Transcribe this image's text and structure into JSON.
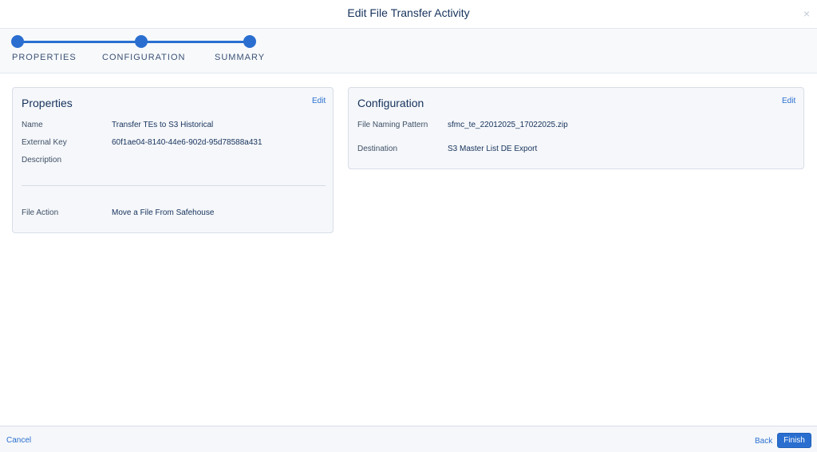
{
  "header": {
    "title": "Edit File Transfer Activity",
    "close_glyph": "×"
  },
  "stepper": {
    "steps": [
      {
        "label": "PROPERTIES"
      },
      {
        "label": "CONFIGURATION"
      },
      {
        "label": "SUMMARY"
      }
    ],
    "active_color": "#2a6fd0"
  },
  "properties": {
    "title": "Properties",
    "edit_label": "Edit",
    "rows": [
      {
        "label": "Name",
        "value": "Transfer TEs to S3 Historical"
      },
      {
        "label": "External Key",
        "value": "60f1ae04-8140-44e6-902d-95d78588a431"
      },
      {
        "label": "Description",
        "value": ""
      },
      {
        "label": "File Action",
        "value": "Move a File From Safehouse"
      }
    ]
  },
  "configuration": {
    "title": "Configuration",
    "edit_label": "Edit",
    "rows": [
      {
        "label": "File Naming Pattern",
        "value": "sfmc_te_22012025_17022025.zip"
      },
      {
        "label": "Destination",
        "value": "S3 Master List DE Export"
      }
    ]
  },
  "footer": {
    "cancel_label": "Cancel",
    "back_label": "Back",
    "finish_label": "Finish"
  }
}
